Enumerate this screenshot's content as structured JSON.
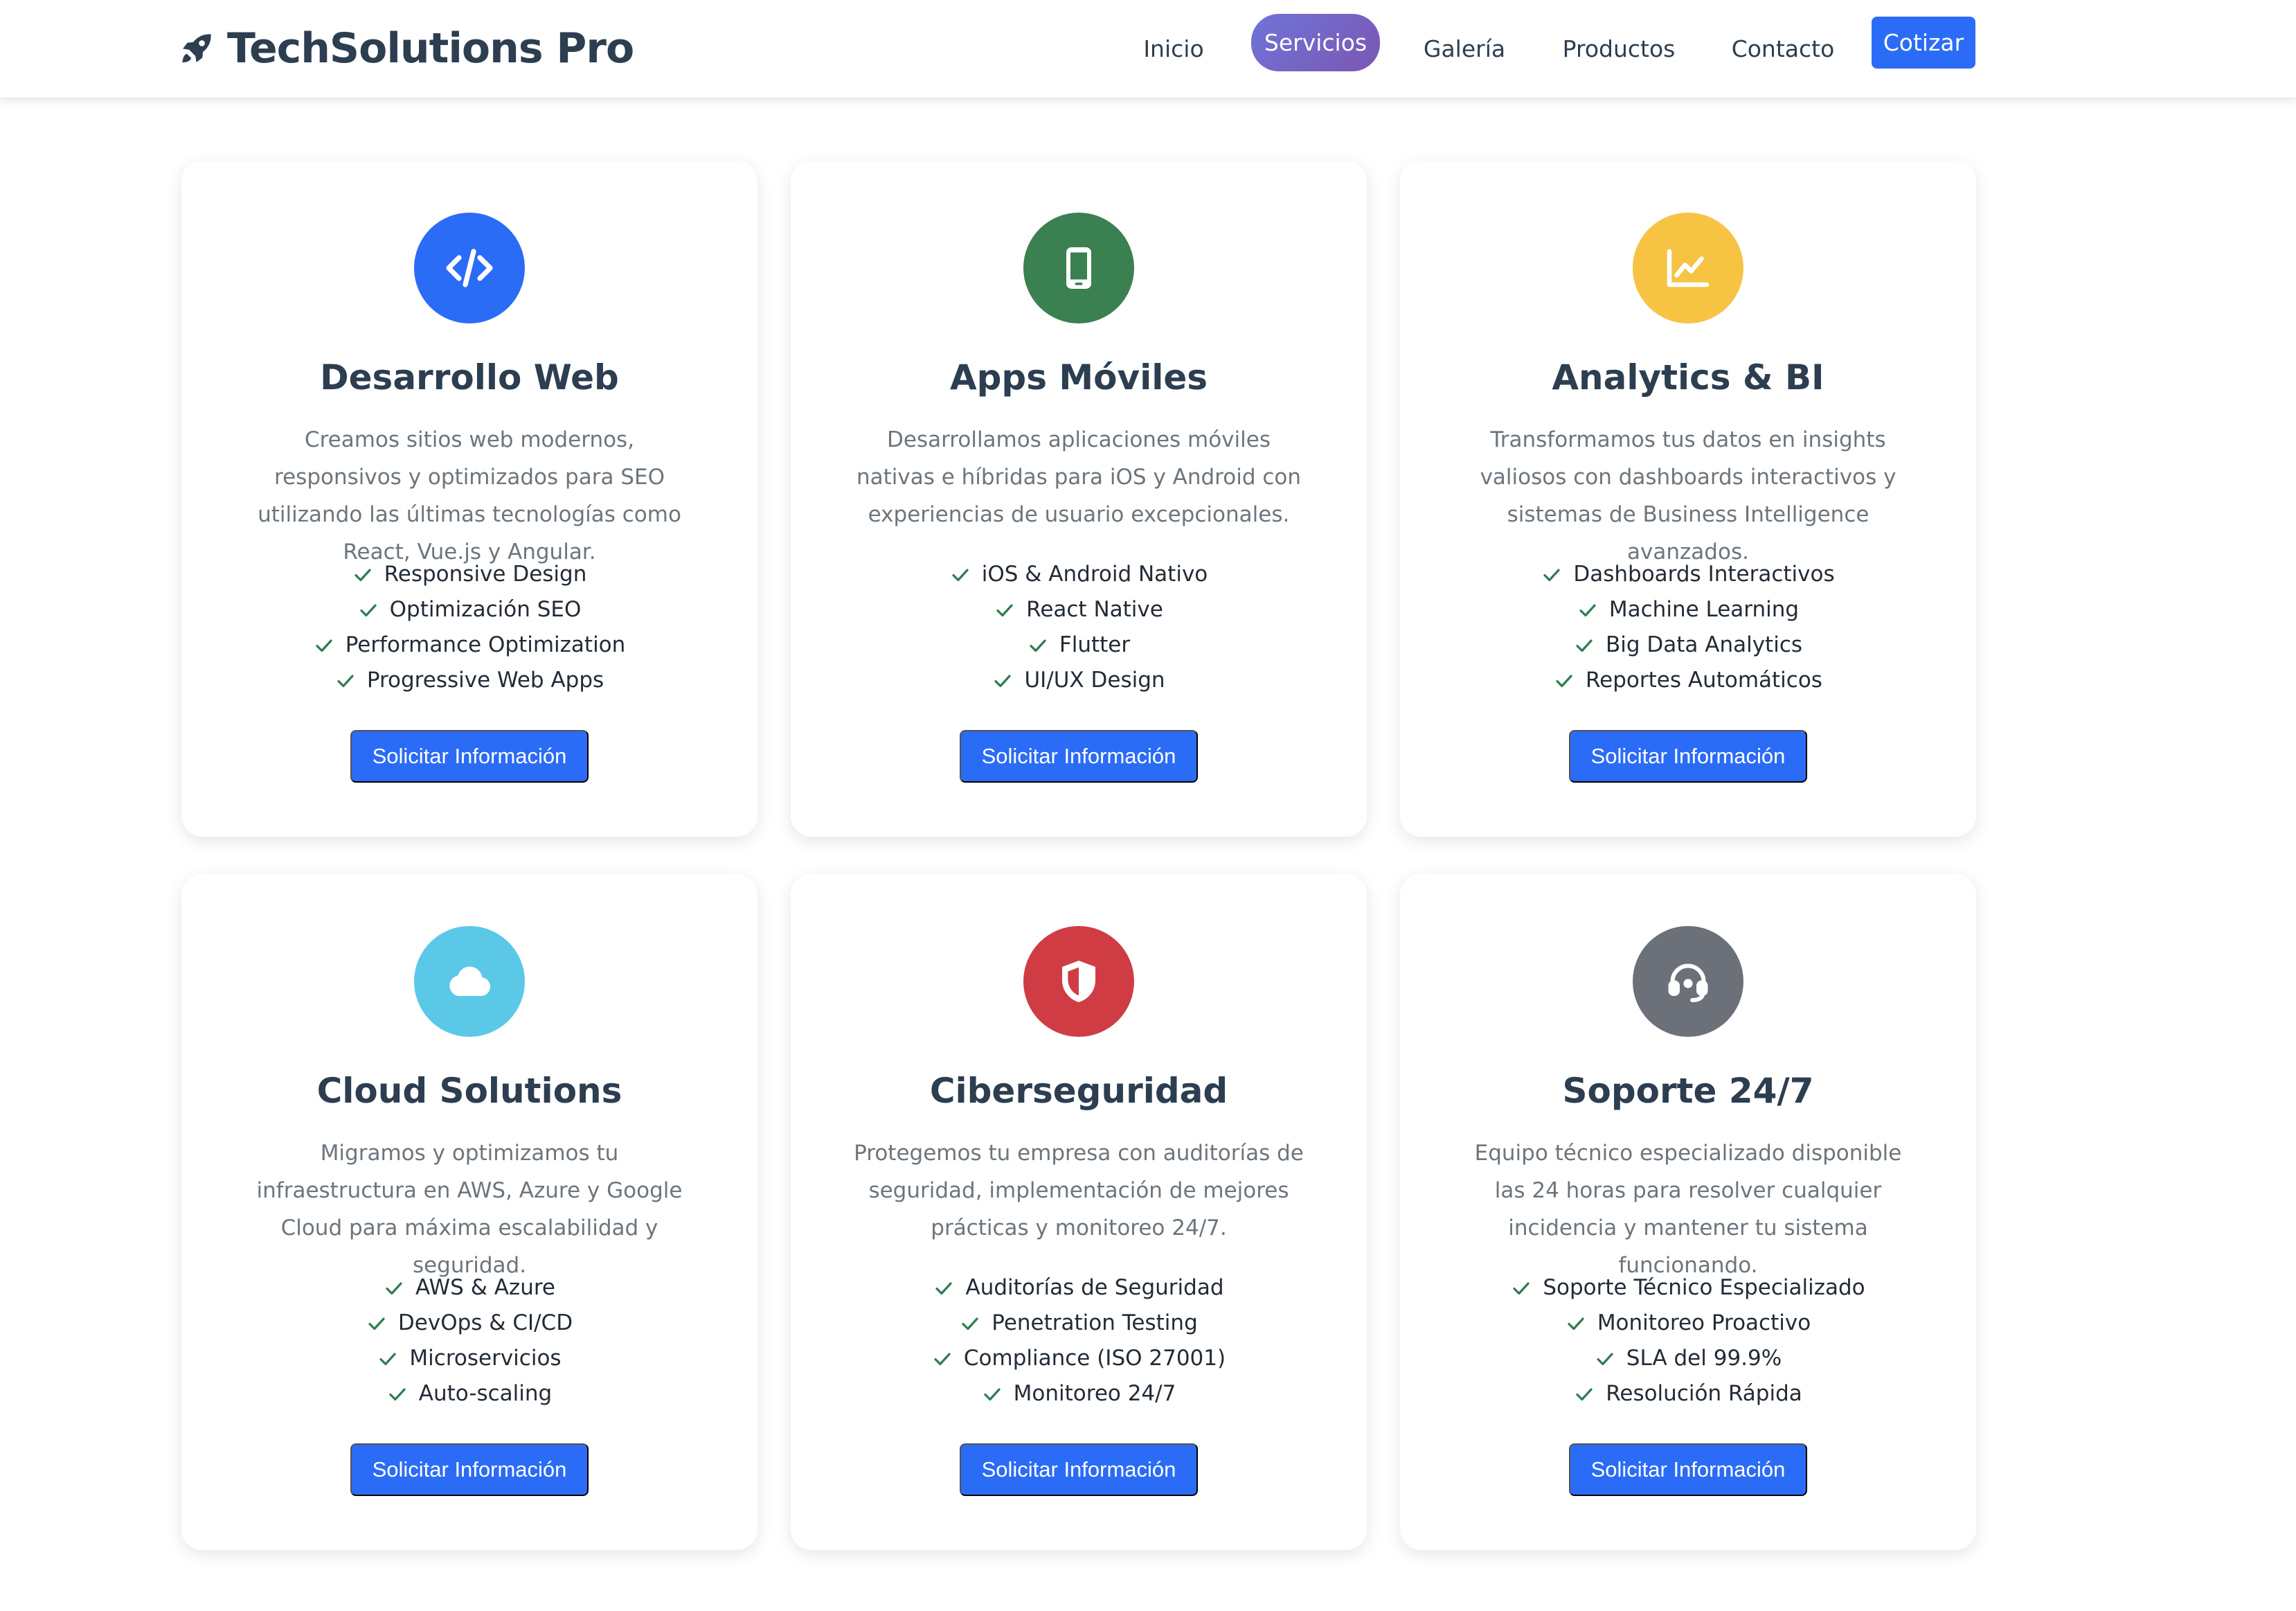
{
  "brand": {
    "name": "TechSolutions Pro",
    "icon": "rocket-icon"
  },
  "nav": {
    "links": [
      "Inicio",
      "Servicios",
      "Galería",
      "Productos",
      "Contacto"
    ],
    "active": "Servicios",
    "cta": "Cotizar"
  },
  "colors": {
    "primary": "#2b6cf6",
    "active_gradient": [
      "#6f74d8",
      "#7b57b3"
    ],
    "check": "#2e7d4f",
    "text": "#2c3e50",
    "muted": "#6c757d"
  },
  "services": [
    {
      "title": "Desarrollo Web",
      "icon": "code-icon",
      "icon_color": "#2b6cf6",
      "description": "Creamos sitios web modernos, responsivos y optimizados para SEO utilizando las últimas tecnologías como React, Vue.js y Angular.",
      "features": [
        "Responsive Design",
        "Optimización SEO",
        "Performance Optimization",
        "Progressive Web Apps"
      ],
      "button": "Solicitar Información"
    },
    {
      "title": "Apps Móviles",
      "icon": "mobile-phone-icon",
      "icon_color": "#3b8050",
      "description": "Desarrollamos aplicaciones móviles nativas e híbridas para iOS y Android con experiencias de usuario excepcionales.",
      "features": [
        "iOS & Android Nativo",
        "React Native",
        "Flutter",
        "UI/UX Design"
      ],
      "button": "Solicitar Información"
    },
    {
      "title": "Analytics & BI",
      "icon": "line-chart-icon",
      "icon_color": "#f6c343",
      "description": "Transformamos tus datos en insights valiosos con dashboards interactivos y sistemas de Business Intelligence avanzados.",
      "features": [
        "Dashboards Interactivos",
        "Machine Learning",
        "Big Data Analytics",
        "Reportes Automáticos"
      ],
      "button": "Solicitar Información"
    },
    {
      "title": "Cloud Solutions",
      "icon": "cloud-icon",
      "icon_color": "#5bc8e8",
      "description": "Migramos y optimizamos tu infraestructura en AWS, Azure y Google Cloud para máxima escalabilidad y seguridad.",
      "features": [
        "AWS & Azure",
        "DevOps & CI/CD",
        "Microservicios",
        "Auto-scaling"
      ],
      "button": "Solicitar Información"
    },
    {
      "title": "Ciberseguridad",
      "icon": "shield-icon",
      "icon_color": "#d03c44",
      "description": "Protegemos tu empresa con auditorías de seguridad, implementación de mejores prácticas y monitoreo 24/7.",
      "features": [
        "Auditorías de Seguridad",
        "Penetration Testing",
        "Compliance (ISO 27001)",
        "Monitoreo 24/7"
      ],
      "button": "Solicitar Información"
    },
    {
      "title": "Soporte 24/7",
      "icon": "headset-icon",
      "icon_color": "#6b7079",
      "description": "Equipo técnico especializado disponible las 24 horas para resolver cualquier incidencia y mantener tu sistema funcionando.",
      "features": [
        "Soporte Técnico Especializado",
        "Monitoreo Proactivo",
        "SLA del 99.9%",
        "Resolución Rápida"
      ],
      "button": "Solicitar Información"
    }
  ]
}
